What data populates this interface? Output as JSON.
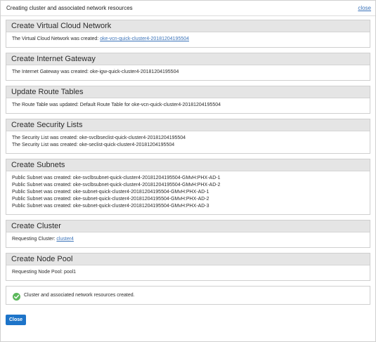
{
  "dialog": {
    "title": "Creating cluster and associated network resources",
    "close_link": "close"
  },
  "sections": {
    "vcn": {
      "title": "Create Virtual Cloud Network",
      "line_prefix": "The Virtual Cloud Network was created: ",
      "line_link": "oke-vcn-quick-cluster4-20181204195504"
    },
    "igw": {
      "title": "Create Internet Gateway",
      "line": "The Internet Gateway was created: oke-igw-quick-cluster4-20181204195504"
    },
    "route": {
      "title": "Update Route Tables",
      "line": "The Route Table was updated: Default Route Table for oke-vcn-quick-cluster4-20181204195504"
    },
    "security": {
      "title": "Create Security Lists",
      "lines": [
        "The Security List was created: oke-svclbseclist-quick-cluster4-20181204195504",
        "The Security List was created: oke-seclist-quick-cluster4-20181204195504"
      ]
    },
    "subnets": {
      "title": "Create Subnets",
      "lines": [
        "Public Subnet was created: oke-svclbsubnet-quick-cluster4-20181204195504-GMvH:PHX-AD-1",
        "Public Subnet was created: oke-svclbsubnet-quick-cluster4-20181204195504-GMvH:PHX-AD-2",
        "Public Subnet was created: oke-subnet-quick-cluster4-20181204195504-GMvH:PHX-AD-1",
        "Public Subnet was created: oke-subnet-quick-cluster4-20181204195504-GMvH:PHX-AD-2",
        "Public Subnet was created: oke-subnet-quick-cluster4-20181204195504-GMvH:PHX-AD-3"
      ]
    },
    "cluster": {
      "title": "Create Cluster",
      "line_prefix": "Requesting Cluster: ",
      "line_link": "cluster4"
    },
    "nodepool": {
      "title": "Create Node Pool",
      "line": "Requesting Node Pool: pool1"
    }
  },
  "result": {
    "icon": "check-circle-icon",
    "text": "Cluster and associated network resources created.",
    "color": "#5cb85c"
  },
  "footer": {
    "close_button": "Close",
    "button_color": "#1d74c9"
  }
}
